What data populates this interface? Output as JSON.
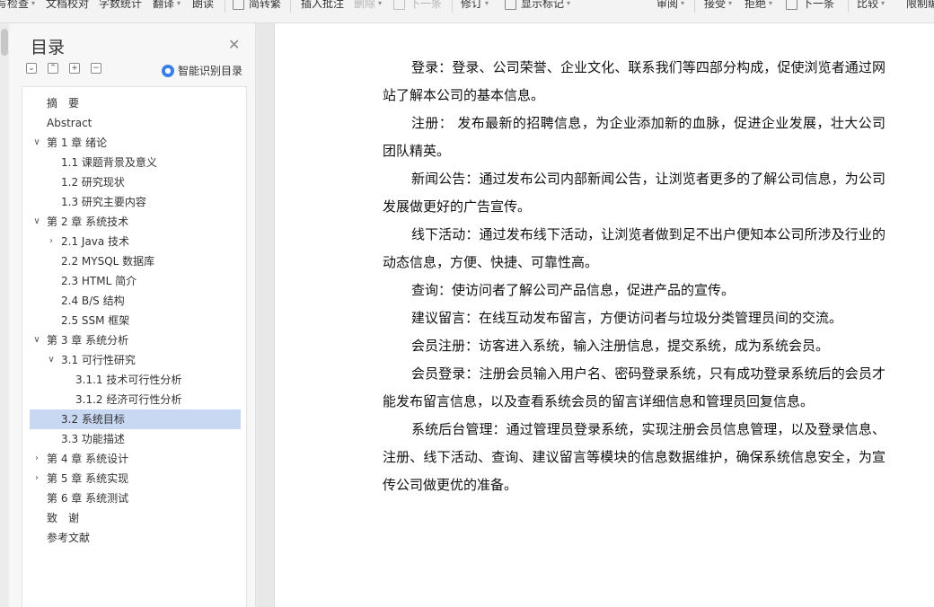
{
  "toolbar": {
    "items": [
      "写检查",
      "文档校对",
      "字数统计",
      "翻译",
      "朗读",
      "简转繁",
      "插入批注",
      "删除",
      "下一条",
      "修订",
      "显示标记",
      "审阅",
      "接受",
      "拒绝",
      "下一条",
      "比较",
      "限制编辑"
    ]
  },
  "toc": {
    "title": "目录",
    "smart_label": "智能识别目录",
    "items": [
      {
        "label": "摘　要"
      },
      {
        "label": "Abstract"
      },
      {
        "label": "第 1 章  绪论"
      },
      {
        "label": "1.1 课题背景及意义"
      },
      {
        "label": "1.2 研究现状"
      },
      {
        "label": "1.3 研究主要内容"
      },
      {
        "label": "第 2 章  系统技术"
      },
      {
        "label": "2.1 Java 技术"
      },
      {
        "label": "2.2 MYSQL 数据库"
      },
      {
        "label": "2.3 HTML 简介"
      },
      {
        "label": "2.4 B/S 结构"
      },
      {
        "label": "2.5 SSM 框架"
      },
      {
        "label": "第 3 章  系统分析"
      },
      {
        "label": "3.1 可行性研究"
      },
      {
        "label": "3.1.1 技术可行性分析"
      },
      {
        "label": "3.1.2 经济可行性分析"
      },
      {
        "label": "3.2 系统目标"
      },
      {
        "label": "3.3 功能描述"
      },
      {
        "label": "第 4 章  系统设计"
      },
      {
        "label": "第 5 章  系统实现"
      },
      {
        "label": "第 6 章  系统测试"
      },
      {
        "label": "致　谢"
      },
      {
        "label": "参考文献"
      }
    ]
  },
  "document": {
    "paragraphs": [
      "登录：登录、公司荣誉、企业文化、联系我们等四部分构成，促使浏览者通过网站了解本公司的基本信息。",
      "注册：  发布最新的招聘信息，为企业添加新的血脉，促进企业发展，壮大公司团队精英。",
      "新闻公告：通过发布公司内部新闻公告，让浏览者更多的了解公司信息，为公司发展做更好的广告宣传。",
      "线下活动：通过发布线下活动，让浏览者做到足不出户便知本公司所涉及行业的动态信息，方便、快捷、可靠性高。",
      "查询：使访问者了解公司产品信息，促进产品的宣传。",
      "建议留言：在线互动发布留言，方便访问者与垃圾分类管理员间的交流。",
      "会员注册：访客进入系统，输入注册信息，提交系统，成为系统会员。",
      "会员登录：注册会员输入用户名、密码登录系统，只有成功登录系统后的会员才能发布留言信息，以及查看系统会员的留言详细信息和管理员回复信息。",
      "系统后台管理：通过管理员登录系统，实现注册会员信息管理，以及登录信息、注册、线下活动、查询、建议留言等模块的信息数据维护，确保系统信息安全，为宣传公司做更优的准备。"
    ]
  }
}
